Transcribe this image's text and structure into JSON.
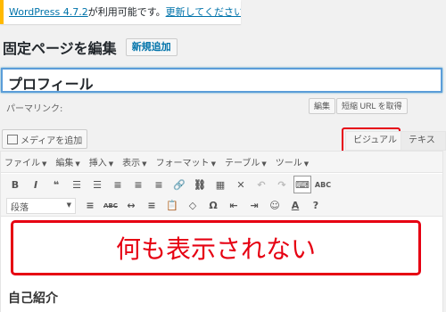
{
  "notice": {
    "version_link": "WordPress 4.7.2",
    "message": "が利用可能です。",
    "update_link": "更新してください。"
  },
  "header": {
    "title": "固定ページを編集",
    "add_new_label": "新規追加"
  },
  "post": {
    "title_value": "プロフィール"
  },
  "permalink": {
    "label": "パーマリンク:",
    "edit_label": "編集",
    "shortlink_label": "短縮 URL を取得"
  },
  "media": {
    "add_media_label": "メディアを追加"
  },
  "tabs": {
    "visual": "ビジュアル",
    "text": "テキスト"
  },
  "menubar": {
    "items": [
      "ファイル",
      "編集",
      "挿入",
      "表示",
      "フォーマット",
      "テーブル",
      "ツール"
    ]
  },
  "toolbar": {
    "row1_icons": [
      "B",
      "I",
      "❝",
      "☰",
      "☰",
      "≡",
      "≡",
      "≡",
      "🔗",
      "⛓",
      "▦",
      "✕",
      "↶",
      "↷",
      "⌨",
      "ABC"
    ],
    "row2_icons": [
      "≡",
      "ABC",
      "↔",
      "≡",
      "📋",
      "◇",
      "Ω",
      "⇤",
      "⇥",
      "☺",
      "A",
      "?"
    ],
    "format_select": "段落"
  },
  "content": {
    "annotation_text": "何も表示されない",
    "subheading": "自己紹介"
  },
  "colors": {
    "accent_red": "#e60012",
    "link_blue": "#0073aa",
    "notice_yellow": "#ffb900"
  }
}
